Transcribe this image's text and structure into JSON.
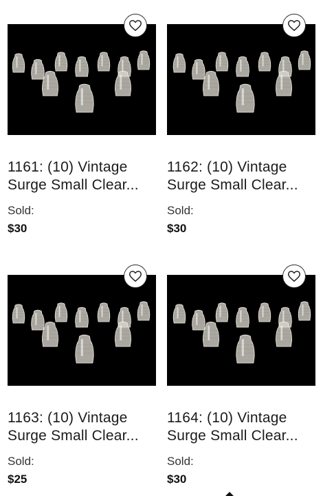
{
  "lots": [
    {
      "title_line1": "1161: (10) Vintage",
      "title_line2": "Surge Small Clear...",
      "sold_label": "Sold:",
      "price": "$30",
      "image": "glass-insulators-photo"
    },
    {
      "title_line1": "1162: (10) Vintage",
      "title_line2": "Surge Small Clear...",
      "sold_label": "Sold:",
      "price": "$30",
      "image": "glass-insulators-photo"
    },
    {
      "title_line1": "1163: (10) Vintage",
      "title_line2": "Surge Small Clear...",
      "sold_label": "Sold:",
      "price": "$25",
      "image": "glass-insulators-photo"
    },
    {
      "title_line1": "1164: (10) Vintage",
      "title_line2": "Surge Small Clear...",
      "sold_label": "Sold:",
      "price": "$30",
      "image": "glass-insulators-photo"
    }
  ],
  "icons": {
    "favorite": "heart-outline-icon"
  },
  "colors": {
    "image_background": "#000000",
    "text": "#1a1a1a"
  }
}
